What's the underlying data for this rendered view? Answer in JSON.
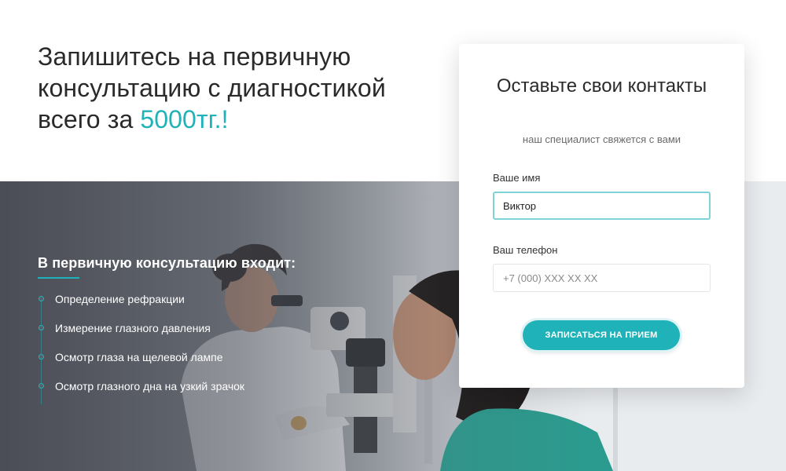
{
  "hero": {
    "line1": "Запишитесь на первичную",
    "line2": "консультацию с диагностикой",
    "line3_prefix": "всего за ",
    "price": "5000тг.",
    "line3_suffix": "!"
  },
  "included": {
    "title": "В первичную консультацию входит:",
    "items": [
      "Определение рефракции",
      "Измерение глазного давления",
      "Осмотр глаза на щелевой лампе",
      "Осмотр глазного дна на узкий зрачок"
    ]
  },
  "form": {
    "title": "Оставьте свои контакты",
    "subtitle": "наш специалист свяжется с вами",
    "name_label": "Ваше имя",
    "name_value": "Виктор",
    "phone_label": "Ваш телефон",
    "phone_placeholder": "+7 (000) XXX XX XX",
    "submit_label": "ЗАПИСАТЬСЯ НА ПРИЕМ"
  },
  "colors": {
    "accent": "#1fb2b8",
    "text_dark": "#2a2a2a",
    "white": "#ffffff"
  },
  "background_image": "photo of ophthalmologist examining patient with slit lamp"
}
